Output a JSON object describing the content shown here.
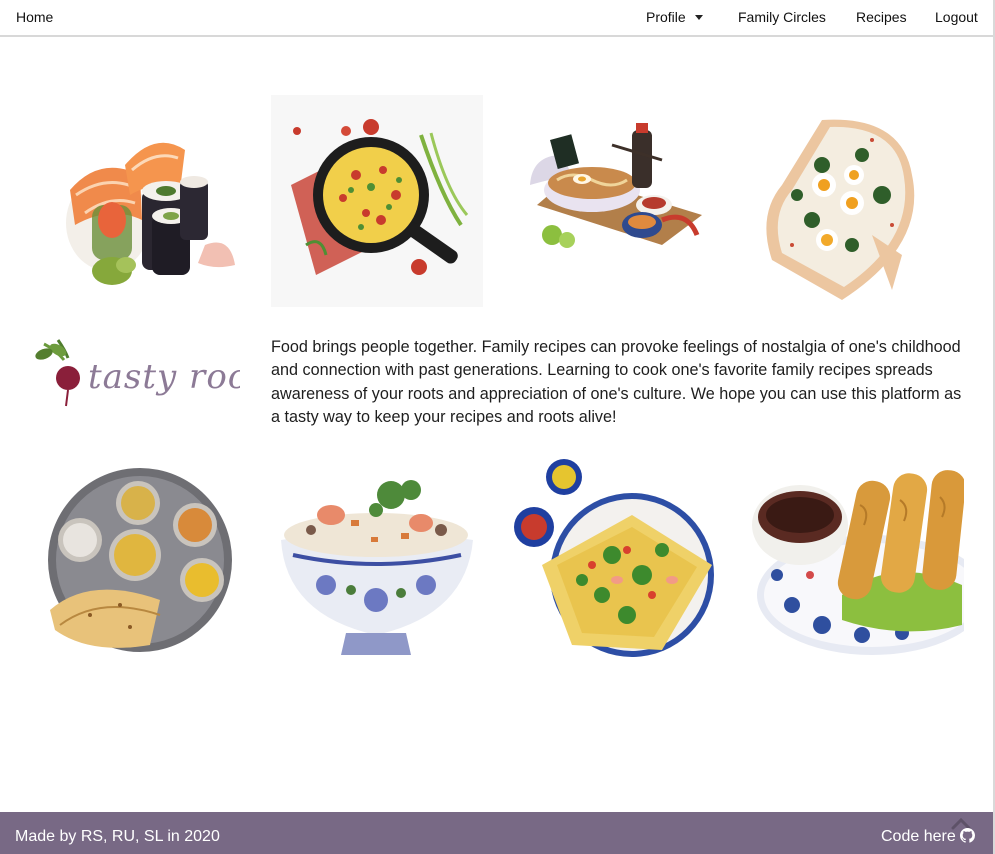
{
  "nav": {
    "home": "Home",
    "profile": "Profile",
    "family_circles": "Family Circles",
    "recipes": "Recipes",
    "logout": "Logout"
  },
  "brand": {
    "logo_text": "tasty roots"
  },
  "about": {
    "text": "Food brings people together. Family recipes can provoke feelings of nostalgia of one's childhood and connection with past generations. Learning to cook one's favorite family recipes spreads awareness of your roots and appreciation of one's culture. We hope you can use this platform as a tasty way to keep your recipes and roots alive!"
  },
  "gallery": {
    "top": [
      "sushi-illustration",
      "skillet-frittata-illustration",
      "ramen-set-illustration",
      "pizza-eggs-illustration"
    ],
    "bottom": [
      "thali-platter-illustration",
      "fried-rice-bowl-illustration",
      "banh-xeo-illustration",
      "spring-rolls-tea-illustration"
    ]
  },
  "footer": {
    "credit": "Made by RS, RU, SL in 2020",
    "code_link": "Code here",
    "code_icon": "github-icon",
    "scroll_icon": "scroll-up-icon"
  },
  "colors": {
    "footer_bg": "#786985",
    "logo_purple": "#8c7a96",
    "beet": "#8a1f3a"
  }
}
